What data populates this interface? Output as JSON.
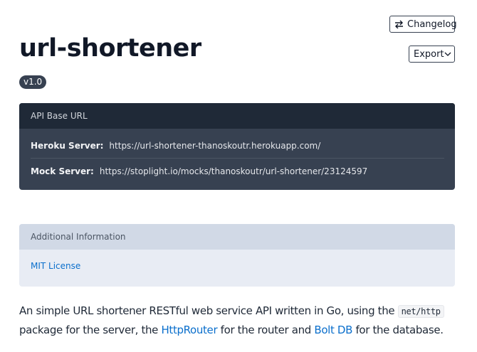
{
  "header": {
    "title": "url-shortener",
    "version": "v1.0",
    "changelog_label": "Changelog",
    "export_label": "Export"
  },
  "api_base": {
    "heading": "API Base URL",
    "servers": [
      {
        "label": "Heroku Server:",
        "url": "https://url-shortener-thanoskoutr.herokuapp.com/"
      },
      {
        "label": "Mock Server:",
        "url": "https://stoplight.io/mocks/thanoskoutr/url-shortener/23124597"
      }
    ]
  },
  "additional_info": {
    "heading": "Additional Information",
    "license": "MIT License"
  },
  "description": {
    "part1": "An simple URL shortener RESTful web service API written in Go, using the ",
    "code": "net/http",
    "part2": " package for the server, the ",
    "link1": "HttpRouter",
    "part3": " for the router and ",
    "link2": "Bolt DB",
    "part4": " for the database."
  },
  "icons": {
    "changelog": "swap-arrows-icon",
    "export": "chevron-down-icon"
  },
  "colors": {
    "link": "#0b6fcc",
    "api_card_bg": "#374151",
    "api_card_head": "#1f2937",
    "info_card_bg": "#e8ecf4",
    "info_card_head": "#d1d9e6"
  }
}
